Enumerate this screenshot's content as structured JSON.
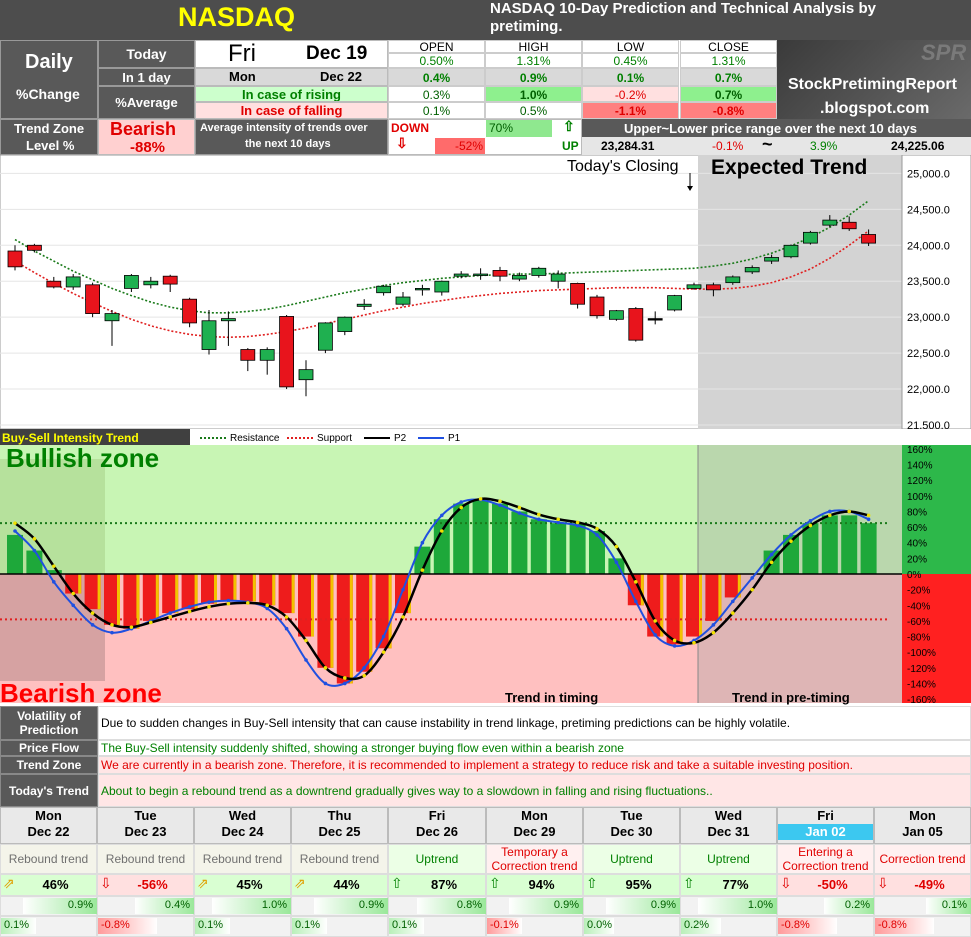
{
  "header": {
    "symbol": "NASDAQ",
    "title": "NASDAQ 10-Day Prediction and Technical Analysis by pretiming.",
    "logo_text": "SPR",
    "blog_line1": "StockPretimingReport",
    "blog_line2": ".blogspot.com"
  },
  "summary": {
    "daily_label": "Daily",
    "change_label": "%Change",
    "today_label": "Today",
    "in1day_label": "In 1 day",
    "average_label": "%Average",
    "today_day": "Fri",
    "today_date": "Dec 19",
    "next_day": "Mon",
    "next_date": "Dec 22",
    "col_headers": [
      "OPEN",
      "HIGH",
      "LOW",
      "CLOSE"
    ],
    "today_values": [
      "0.50%",
      "1.31%",
      "0.45%",
      "1.31%"
    ],
    "in1day_values": [
      "0.4%",
      "0.9%",
      "0.1%",
      "0.7%"
    ],
    "rising_label": "In case of rising",
    "rising_values": [
      "0.3%",
      "1.0%",
      "-0.2%",
      "0.7%"
    ],
    "falling_label": "In case of falling",
    "falling_values": [
      "0.1%",
      "0.5%",
      "-1.1%",
      "-0.8%"
    ]
  },
  "trend_zone": {
    "label_line1": "Trend Zone",
    "label_line2": "Level %",
    "zone": "Bearish",
    "level": "-88%",
    "avg_intensity_line1": "Average intensity of trends over",
    "avg_intensity_line2": "the next 10 days",
    "down_label": "DOWN",
    "down_value": "-52%",
    "up_value": "70%",
    "up_label": "UP",
    "range_title": "Upper~Lower price range over the next 10 days",
    "range_low": "23,284.31",
    "range_low_pct": "-0.1%",
    "range_sep": "~",
    "range_high_pct": "3.9%",
    "range_high": "24,225.06"
  },
  "price_chart": {
    "todays_closing": "Today's Closing",
    "expected_trend": "Expected Trend",
    "y_ticks": [
      "25,000.0",
      "24,500.0",
      "24,000.0",
      "23,500.0",
      "23,000.0",
      "22,500.0",
      "22,000.0",
      "21,500.0"
    ]
  },
  "chart_data": [
    {
      "type": "candlestick",
      "ylim": [
        21500,
        25200
      ],
      "candles": [
        {
          "o": 23920,
          "c": 23700,
          "h": 24000,
          "l": 23650,
          "color": "red"
        },
        {
          "o": 24000,
          "c": 23930,
          "h": 24020,
          "l": 23900,
          "color": "red"
        },
        {
          "o": 23500,
          "c": 23420,
          "h": 23560,
          "l": 23400,
          "color": "red"
        },
        {
          "o": 23420,
          "c": 23560,
          "h": 23600,
          "l": 23380,
          "color": "green"
        },
        {
          "o": 23450,
          "c": 23050,
          "h": 23480,
          "l": 23000,
          "color": "red"
        },
        {
          "o": 22950,
          "c": 23050,
          "h": 23100,
          "l": 22600,
          "color": "green"
        },
        {
          "o": 23400,
          "c": 23580,
          "h": 23600,
          "l": 23350,
          "color": "green"
        },
        {
          "o": 23450,
          "c": 23500,
          "h": 23560,
          "l": 23400,
          "color": "green"
        },
        {
          "o": 23570,
          "c": 23460,
          "h": 23590,
          "l": 23350,
          "color": "red"
        },
        {
          "o": 23250,
          "c": 22920,
          "h": 23270,
          "l": 22860,
          "color": "red"
        },
        {
          "o": 22550,
          "c": 22950,
          "h": 23100,
          "l": 22480,
          "color": "green"
        },
        {
          "o": 22950,
          "c": 22980,
          "h": 23080,
          "l": 22600,
          "color": "green"
        },
        {
          "o": 22550,
          "c": 22400,
          "h": 22570,
          "l": 22250,
          "color": "red"
        },
        {
          "o": 22400,
          "c": 22550,
          "h": 22580,
          "l": 22200,
          "color": "green"
        },
        {
          "o": 23010,
          "c": 22030,
          "h": 23030,
          "l": 22000,
          "color": "red"
        },
        {
          "o": 22130,
          "c": 22270,
          "h": 22400,
          "l": 21900,
          "color": "green"
        },
        {
          "o": 22540,
          "c": 22920,
          "h": 22930,
          "l": 22500,
          "color": "green"
        },
        {
          "o": 22800,
          "c": 23000,
          "h": 23010,
          "l": 22750,
          "color": "green"
        },
        {
          "o": 23150,
          "c": 23180,
          "h": 23250,
          "l": 23100,
          "color": "green"
        },
        {
          "o": 23340,
          "c": 23430,
          "h": 23450,
          "l": 23300,
          "color": "green"
        },
        {
          "o": 23180,
          "c": 23280,
          "h": 23350,
          "l": 23150,
          "color": "green"
        },
        {
          "o": 23380,
          "c": 23400,
          "h": 23450,
          "l": 23300,
          "color": "green"
        },
        {
          "o": 23350,
          "c": 23500,
          "h": 23510,
          "l": 23300,
          "color": "green"
        },
        {
          "o": 23570,
          "c": 23600,
          "h": 23640,
          "l": 23540,
          "color": "green"
        },
        {
          "o": 23600,
          "c": 23600,
          "h": 23680,
          "l": 23520,
          "color": "green"
        },
        {
          "o": 23650,
          "c": 23570,
          "h": 23700,
          "l": 23500,
          "color": "red"
        },
        {
          "o": 23530,
          "c": 23580,
          "h": 23620,
          "l": 23500,
          "color": "green"
        },
        {
          "o": 23580,
          "c": 23680,
          "h": 23700,
          "l": 23550,
          "color": "green"
        },
        {
          "o": 23500,
          "c": 23600,
          "h": 23650,
          "l": 23400,
          "color": "green"
        },
        {
          "o": 23470,
          "c": 23180,
          "h": 23480,
          "l": 23120,
          "color": "red"
        },
        {
          "o": 23280,
          "c": 23020,
          "h": 23310,
          "l": 22980,
          "color": "red"
        },
        {
          "o": 22970,
          "c": 23090,
          "h": 23100,
          "l": 22950,
          "color": "green"
        },
        {
          "o": 23120,
          "c": 22680,
          "h": 23140,
          "l": 22660,
          "color": "red"
        },
        {
          "o": 22980,
          "c": 22980,
          "h": 23080,
          "l": 22900,
          "color": "black"
        },
        {
          "o": 23100,
          "c": 23300,
          "h": 23310,
          "l": 23080,
          "color": "green"
        },
        {
          "o": 23400,
          "c": 23450,
          "h": 23480,
          "l": 23380,
          "color": "green"
        },
        {
          "o": 23450,
          "c": 23380,
          "h": 23480,
          "l": 23290,
          "color": "red"
        },
        {
          "o": 23480,
          "c": 23560,
          "h": 23580,
          "l": 23450,
          "color": "green"
        },
        {
          "o": 23630,
          "c": 23690,
          "h": 23720,
          "l": 23600,
          "color": "green"
        },
        {
          "o": 23780,
          "c": 23830,
          "h": 23870,
          "l": 23740,
          "color": "green"
        },
        {
          "o": 23840,
          "c": 24000,
          "h": 24010,
          "l": 23820,
          "color": "green"
        },
        {
          "o": 24030,
          "c": 24180,
          "h": 24200,
          "l": 24010,
          "color": "green"
        },
        {
          "o": 24280,
          "c": 24350,
          "h": 24420,
          "l": 24250,
          "color": "green"
        },
        {
          "o": 24320,
          "c": 24230,
          "h": 24400,
          "l": 24200,
          "color": "red"
        },
        {
          "o": 24150,
          "c": 24030,
          "h": 24220,
          "l": 23990,
          "color": "red"
        }
      ],
      "resistance": [
        24080,
        23920,
        23780,
        23640,
        23520,
        23400,
        23300,
        23210,
        23140,
        23090,
        23060,
        23060,
        23080,
        23110,
        23160,
        23220,
        23280,
        23340,
        23390,
        23440,
        23480,
        23510,
        23540,
        23560,
        23580,
        23590,
        23600,
        23600,
        23610,
        23620,
        23630,
        23640,
        23650,
        23660,
        23670,
        23680,
        23710,
        23750,
        23810,
        23890,
        23990,
        24110,
        24250,
        24420,
        24620
      ],
      "support": [
        23780,
        23620,
        23470,
        23330,
        23200,
        23080,
        22970,
        22880,
        22810,
        22760,
        22730,
        22720,
        22730,
        22760,
        22800,
        22850,
        22910,
        22970,
        23030,
        23090,
        23140,
        23190,
        23230,
        23270,
        23300,
        23330,
        23350,
        23370,
        23380,
        23390,
        23400,
        23410,
        23410,
        23410,
        23400,
        23390,
        23390,
        23400,
        23430,
        23480,
        23560,
        23670,
        23820,
        24000,
        24200
      ]
    },
    {
      "type": "bar",
      "title": "Buy-Sell Intensity Trend",
      "legend": [
        "Resistance",
        "Support",
        "P2",
        "P1"
      ],
      "ylim": [
        -165,
        165
      ],
      "y_ticks": [
        "160%",
        "140%",
        "120%",
        "100%",
        "80%",
        "60%",
        "40%",
        "20%",
        "0%",
        "-20%",
        "-40%",
        "-60%",
        "-80%",
        "-100%",
        "-120%",
        "-140%",
        "-160%"
      ],
      "bullish_label": "Bullish zone",
      "bearish_label": "Bearish zone",
      "timing_label": "Trend in timing",
      "pretiming_label": "Trend in pre-timing",
      "resistance_level": 65,
      "support_level": -58,
      "values": [
        50,
        30,
        5,
        -25,
        -45,
        -65,
        -70,
        -60,
        -50,
        -45,
        -38,
        -35,
        -35,
        -40,
        -50,
        -80,
        -120,
        -140,
        -125,
        -95,
        -50,
        35,
        70,
        90,
        95,
        90,
        80,
        70,
        65,
        65,
        55,
        20,
        -40,
        -80,
        -90,
        -80,
        -60,
        -30,
        0,
        30,
        50,
        65,
        75,
        75,
        65
      ],
      "p1": [
        55,
        30,
        -10,
        -40,
        -65,
        -75,
        -70,
        -60,
        -50,
        -42,
        -36,
        -34,
        -36,
        -44,
        -70,
        -110,
        -140,
        -140,
        -120,
        -80,
        -20,
        40,
        75,
        92,
        95,
        88,
        78,
        70,
        66,
        62,
        50,
        15,
        -35,
        -78,
        -92,
        -85,
        -65,
        -35,
        -5,
        25,
        50,
        68,
        80,
        80,
        70
      ],
      "p2": [
        65,
        45,
        10,
        -25,
        -50,
        -65,
        -68,
        -62,
        -55,
        -48,
        -42,
        -38,
        -37,
        -40,
        -55,
        -85,
        -120,
        -133,
        -130,
        -100,
        -55,
        5,
        55,
        85,
        96,
        93,
        85,
        76,
        70,
        66,
        58,
        35,
        -10,
        -60,
        -85,
        -88,
        -75,
        -50,
        -20,
        15,
        42,
        62,
        75,
        80,
        75
      ]
    }
  ],
  "notes": [
    {
      "label": "Volatility of Prediction",
      "text": "Due to sudden changes in Buy-Sell intensity that can cause instability in trend linkage, pretiming predictions can be highly volatile.",
      "color": "#000000"
    },
    {
      "label": "Price Flow",
      "text": "The Buy-Sell intensity suddenly shifted, showing a stronger buying flow even within a bearish zone",
      "color": "#008000"
    },
    {
      "label": "Trend Zone",
      "text": "We are currently in a bearish zone. Therefore, it is recommended to implement a strategy to reduce risk and take a suitable investing position.",
      "color": "#e00000"
    },
    {
      "label": "Today's Trend",
      "text": "About to begin a rebound trend as a downtrend gradually gives way to a slowdown in falling and rising fluctuations..",
      "color": "#008000"
    }
  ],
  "forecast": [
    {
      "day": "Mon",
      "date": "Dec 22",
      "trend": "Rebound trend",
      "trend_color": "#707070",
      "arrow": "⇗",
      "arrow_color": "#e0a000",
      "pct": "46%",
      "pct_color": "#000",
      "rise": "0.9%",
      "fall": "0.1%",
      "rise_frac": 0.35,
      "fall_frac": 0.05,
      "fall_neg": false,
      "highlight": false
    },
    {
      "day": "Tue",
      "date": "Dec 23",
      "trend": "Rebound trend",
      "trend_color": "#707070",
      "arrow": "⇩",
      "arrow_color": "#e00000",
      "pct": "-56%",
      "pct_color": "#e00000",
      "rise": "0.4%",
      "fall": "-0.8%",
      "rise_frac": 0.2,
      "fall_frac": 0.3,
      "fall_neg": true,
      "highlight": false
    },
    {
      "day": "Wed",
      "date": "Dec 24",
      "trend": "Rebound trend",
      "trend_color": "#707070",
      "arrow": "⇗",
      "arrow_color": "#e0a000",
      "pct": "45%",
      "pct_color": "#000",
      "rise": "1.0%",
      "fall": "0.1%",
      "rise_frac": 0.4,
      "fall_frac": 0.05,
      "fall_neg": false,
      "highlight": false
    },
    {
      "day": "Thu",
      "date": "Dec 25",
      "trend": "Rebound trend",
      "trend_color": "#707070",
      "arrow": "⇗",
      "arrow_color": "#e0a000",
      "pct": "44%",
      "pct_color": "#000",
      "rise": "0.9%",
      "fall": "0.1%",
      "rise_frac": 0.35,
      "fall_frac": 0.05,
      "fall_neg": false,
      "highlight": false
    },
    {
      "day": "Fri",
      "date": "Dec 26",
      "trend": "Uptrend",
      "trend_color": "#008000",
      "arrow": "⇧",
      "arrow_color": "#008000",
      "pct": "87%",
      "pct_color": "#000",
      "rise": "0.8%",
      "fall": "0.1%",
      "rise_frac": 0.3,
      "fall_frac": 0.05,
      "fall_neg": false,
      "highlight": false
    },
    {
      "day": "Mon",
      "date": "Dec 29",
      "trend": "Temporary a Correction trend",
      "trend_color": "#e00000",
      "arrow": "⇧",
      "arrow_color": "#008000",
      "pct": "94%",
      "pct_color": "#000",
      "rise": "0.9%",
      "fall": "-0.1%",
      "rise_frac": 0.35,
      "fall_frac": 0.05,
      "fall_neg": true,
      "highlight": false
    },
    {
      "day": "Tue",
      "date": "Dec 30",
      "trend": "Uptrend",
      "trend_color": "#008000",
      "arrow": "⇧",
      "arrow_color": "#008000",
      "pct": "95%",
      "pct_color": "#000",
      "rise": "0.9%",
      "fall": "0.0%",
      "rise_frac": 0.35,
      "fall_frac": 0.0,
      "fall_neg": false,
      "highlight": false
    },
    {
      "day": "Wed",
      "date": "Dec 31",
      "trend": "Uptrend",
      "trend_color": "#008000",
      "arrow": "⇧",
      "arrow_color": "#008000",
      "pct": "77%",
      "pct_color": "#000",
      "rise": "1.0%",
      "fall": "0.2%",
      "rise_frac": 0.4,
      "fall_frac": 0.1,
      "fall_neg": false,
      "highlight": false
    },
    {
      "day": "Fri",
      "date": "Jan 02",
      "trend": "Entering a Correction trend",
      "trend_color": "#e00000",
      "arrow": "⇩",
      "arrow_color": "#e00000",
      "pct": "-50%",
      "pct_color": "#e00000",
      "rise": "0.2%",
      "fall": "-0.8%",
      "rise_frac": 0.1,
      "fall_frac": 0.3,
      "fall_neg": true,
      "highlight": true
    },
    {
      "day": "Mon",
      "date": "Jan 05",
      "trend": "Correction trend",
      "trend_color": "#e00000",
      "arrow": "⇩",
      "arrow_color": "#e00000",
      "pct": "-49%",
      "pct_color": "#e00000",
      "rise": "0.1%",
      "fall": "-0.8%",
      "rise_frac": 0.05,
      "fall_frac": 0.3,
      "fall_neg": true,
      "highlight": false
    }
  ]
}
